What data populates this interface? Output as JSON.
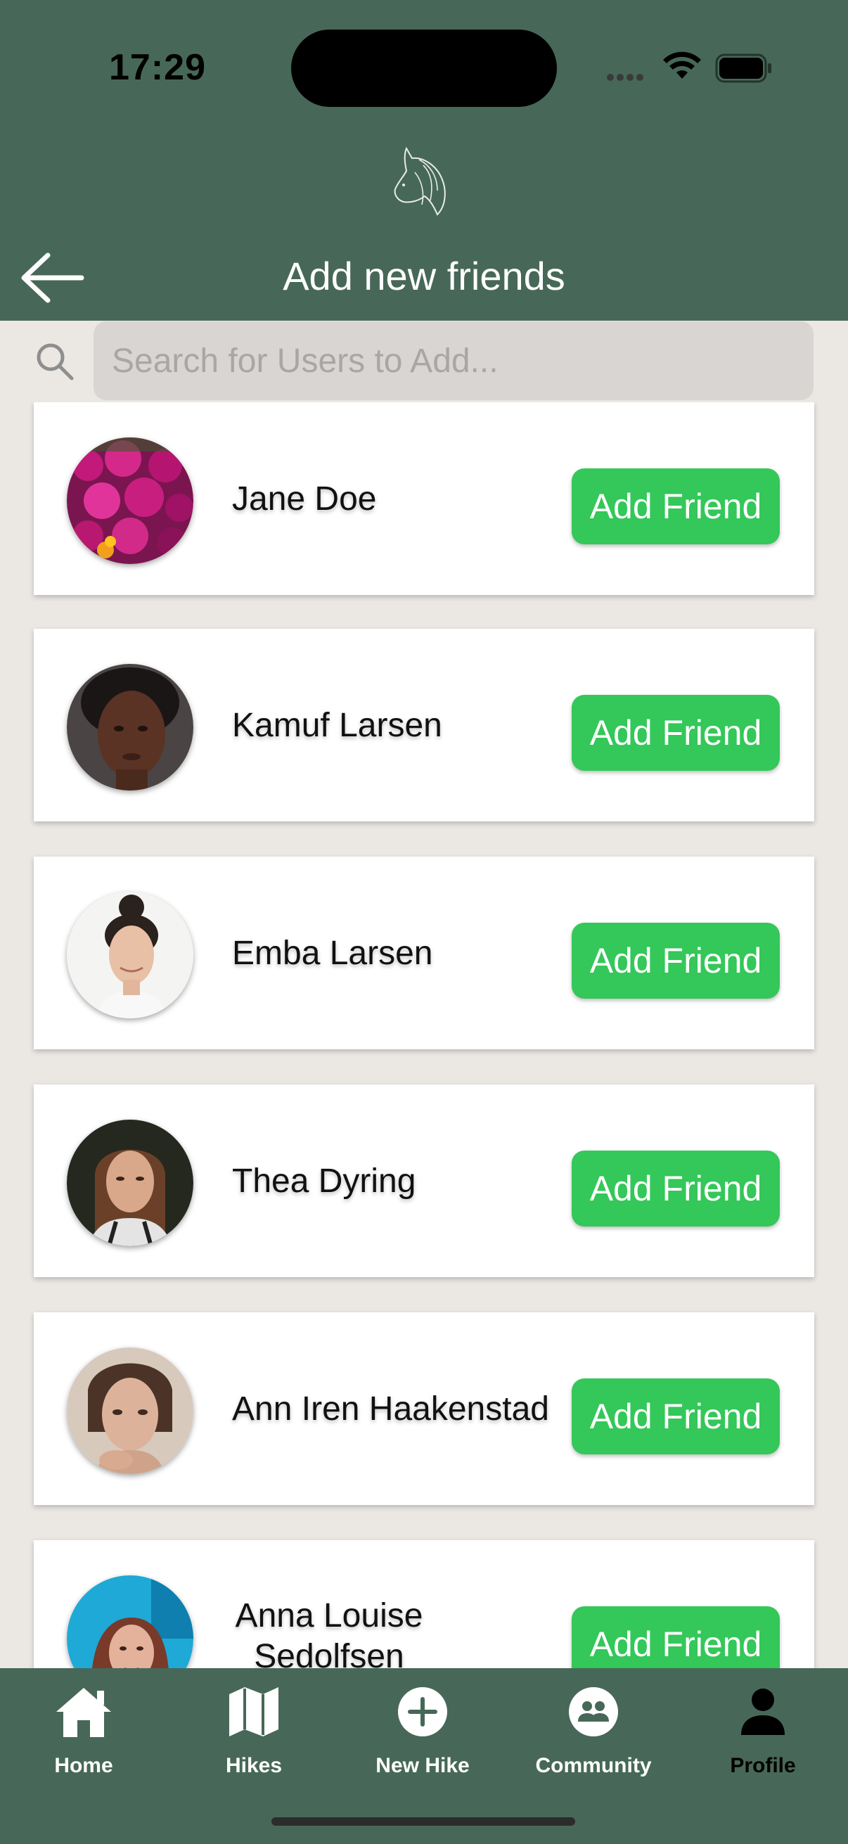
{
  "status_bar": {
    "time": "17:29"
  },
  "header": {
    "title": "Add new friends"
  },
  "search": {
    "placeholder": "Search for Users to Add..."
  },
  "users": [
    {
      "name": "Jane Doe",
      "button": "Add Friend"
    },
    {
      "name": "Kamuf Larsen",
      "button": "Add Friend"
    },
    {
      "name": "Emba Larsen",
      "button": "Add Friend"
    },
    {
      "name": "Thea Dyring",
      "button": "Add Friend"
    },
    {
      "name": "Ann Iren Haakenstad",
      "button": "Add Friend"
    },
    {
      "name": "Anna Louise Sedolfsen",
      "button": "Add Friend"
    }
  ],
  "tabbar": {
    "items": [
      {
        "label": "Home",
        "icon": "home-icon"
      },
      {
        "label": "Hikes",
        "icon": "map-icon"
      },
      {
        "label": "New Hike",
        "icon": "plus-circle-icon"
      },
      {
        "label": "Community",
        "icon": "community-icon"
      },
      {
        "label": "Profile",
        "icon": "person-icon",
        "active": true
      }
    ]
  },
  "colors": {
    "header_bg": "#476858",
    "accent_green": "#34c759",
    "page_bg": "#ebe8e4"
  }
}
